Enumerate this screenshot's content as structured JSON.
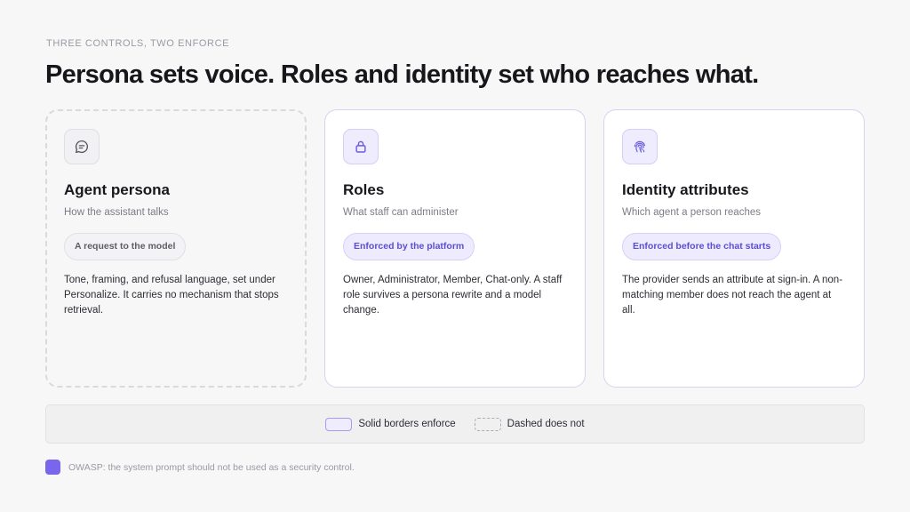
{
  "header": {
    "eyebrow": "THREE CONTROLS, TWO ENFORCE",
    "title": "Persona sets voice. Roles and identity set who reaches what."
  },
  "cards": [
    {
      "icon": "chat-bubble-icon",
      "title": "Agent persona",
      "subtitle": "How the assistant talks",
      "pill": "A request to the model",
      "body": "Tone, framing, and refusal language, set under Personalize. It carries no mechanism that stops retrieval.",
      "border": "dashed"
    },
    {
      "icon": "lock-icon",
      "title": "Roles",
      "subtitle": "What staff can administer",
      "pill": "Enforced by the platform",
      "body": "Owner, Administrator, Member, Chat-only. A staff role survives a persona rewrite and a model change.",
      "border": "solid"
    },
    {
      "icon": "fingerprint-icon",
      "title": "Identity attributes",
      "subtitle": "Which agent a person reaches",
      "pill": "Enforced before the chat starts",
      "body": "The provider sends an attribute at sign-in. A non-matching member does not reach the agent at all.",
      "border": "solid"
    }
  ],
  "legend": {
    "solid_label": "Solid borders enforce",
    "dashed_label": "Dashed does not"
  },
  "footnote": {
    "text": "OWASP: the system prompt should not be used as a security control."
  },
  "colors": {
    "accent": "#7867ec",
    "accent_soft": "#eeecfd",
    "accent_text": "#5a4fd0",
    "neutral_border": "#d9d9de"
  }
}
